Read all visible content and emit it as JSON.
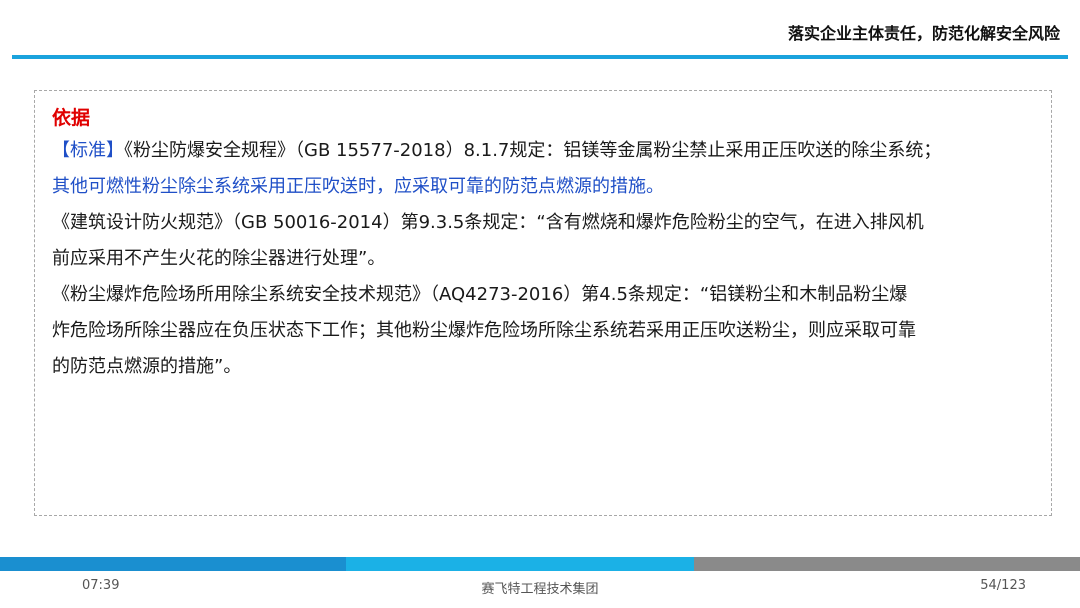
{
  "header": {
    "title": "落实企业主体责任，防范化解安全风险"
  },
  "content": {
    "heading": "依据",
    "p1": {
      "tag": "【标准】",
      "line1_rest": "《粉尘防爆安全规程》（GB 15577-2018）8.1.7规定：铝镁等金属粉尘禁止采用正压吹送的除尘系统；",
      "line2": "其他可燃性粉尘除尘系统采用正压吹送时，应采取可靠的防范点燃源的措施。"
    },
    "p2": {
      "line1": "《建筑设计防火规范》（GB 50016-2014）第9.3.5条规定：“含有燃烧和爆炸危险粉尘的空气，在进入排风机",
      "line2": "前应采用不产生火花的除尘器进行处理”。"
    },
    "p3": {
      "line1": "《粉尘爆炸危险场所用除尘系统安全技术规范》（AQ4273-2016）第4.5条规定：“铝镁粉尘和木制品粉尘爆",
      "line2": "炸危险场所除尘器应在负压状态下工作；其他粉尘爆炸危险场所除尘系统若采用正压吹送粉尘，则应采取可靠",
      "line3": "的防范点燃源的措施”。"
    }
  },
  "footer": {
    "time": "07:39",
    "organization": "赛飞特工程技术集团",
    "page": "54/123"
  },
  "colors": {
    "accent": "#1aa3dd",
    "heading_red": "#e00000",
    "highlight_blue": "#1f4fc7"
  }
}
